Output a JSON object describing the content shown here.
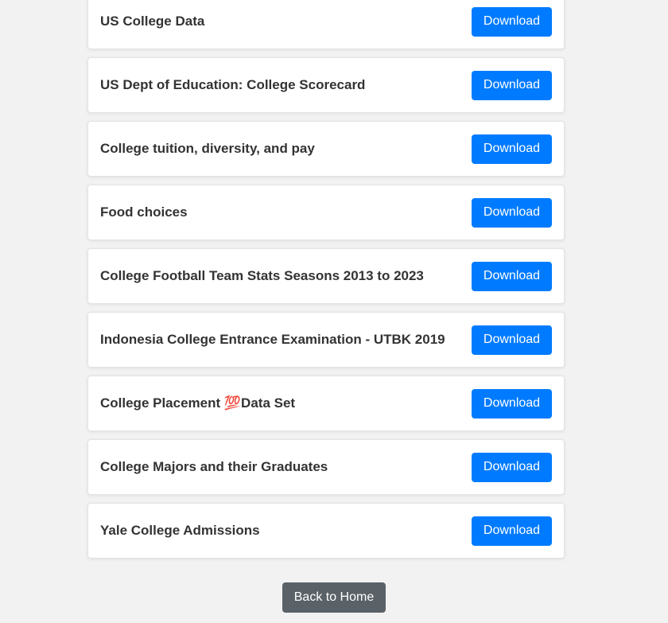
{
  "datasets": [
    {
      "title": "US College Data",
      "button": "Download"
    },
    {
      "title": "US Dept of Education: College Scorecard",
      "button": "Download"
    },
    {
      "title": "College tuition, diversity, and pay",
      "button": "Download"
    },
    {
      "title": "Food choices",
      "button": "Download"
    },
    {
      "title": "College Football Team Stats Seasons 2013 to 2023",
      "button": "Download"
    },
    {
      "title": "Indonesia College Entrance Examination - UTBK 2019",
      "button": "Download"
    },
    {
      "title": "College Placement 💯Data Set",
      "button": "Download"
    },
    {
      "title": "College Majors and their Graduates",
      "button": "Download"
    },
    {
      "title": "Yale College Admissions",
      "button": "Download"
    }
  ],
  "footer": {
    "back_label": "Back to Home"
  },
  "colors": {
    "primary": "#007bff",
    "secondary": "#5a6268",
    "background": "#f2f2f2"
  }
}
